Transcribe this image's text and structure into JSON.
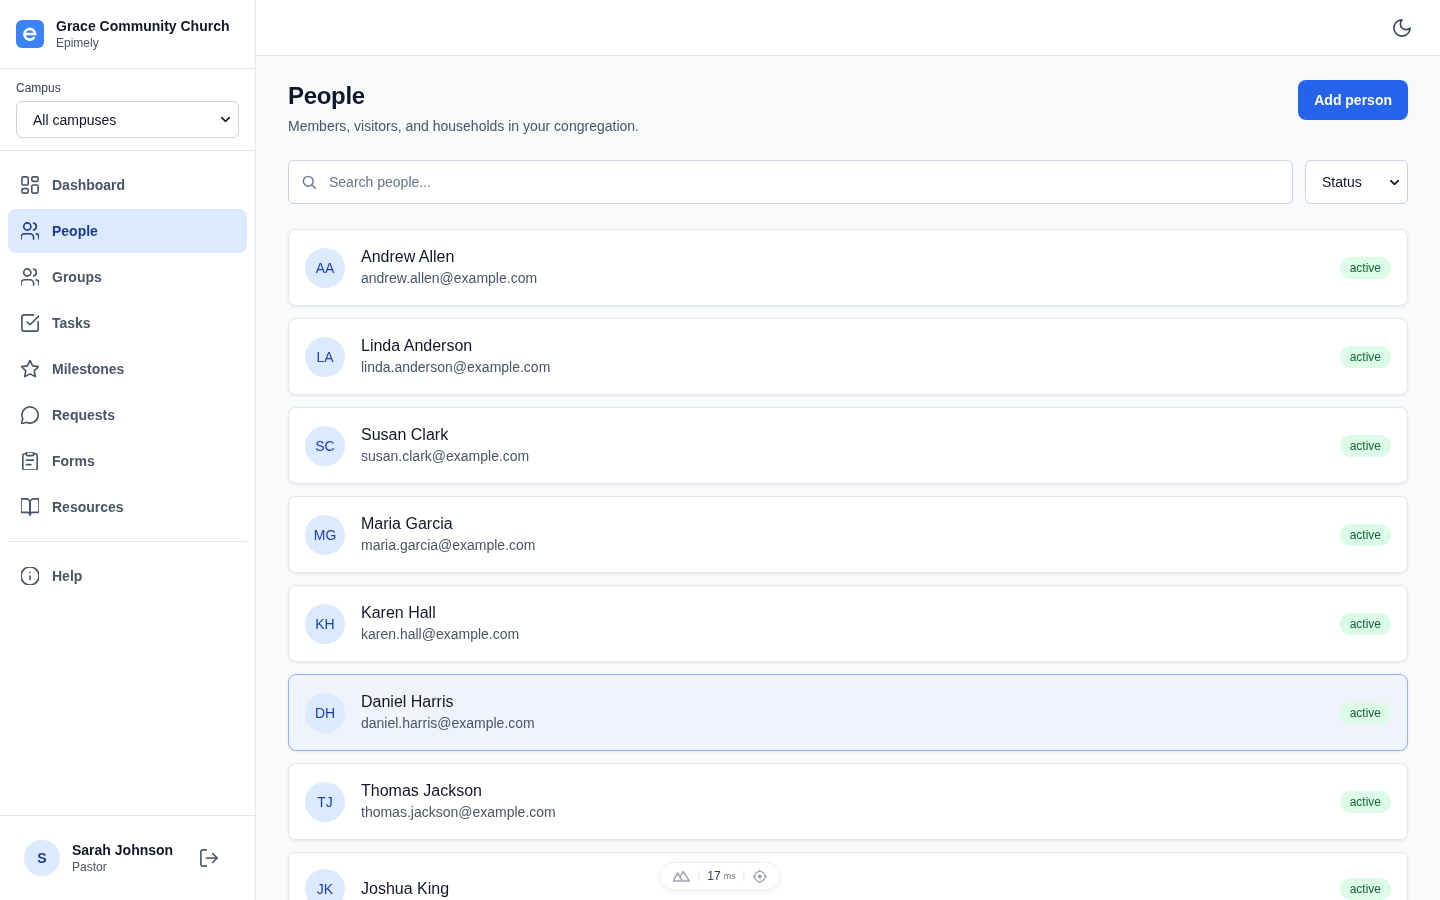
{
  "sidebar": {
    "org": {
      "name": "Grace Community Church",
      "subtitle": "Epimely"
    },
    "campus": {
      "label": "Campus",
      "value": "All campuses"
    },
    "nav": [
      {
        "label": "Dashboard",
        "selected": false
      },
      {
        "label": "People",
        "selected": true
      },
      {
        "label": "Groups",
        "selected": false
      },
      {
        "label": "Tasks",
        "selected": false
      },
      {
        "label": "Milestones",
        "selected": false
      },
      {
        "label": "Requests",
        "selected": false
      },
      {
        "label": "Forms",
        "selected": false
      },
      {
        "label": "Resources",
        "selected": false
      }
    ],
    "footer_nav": [
      {
        "label": "Help",
        "selected": false
      }
    ],
    "user": {
      "initials": "S",
      "name": "Sarah Johnson",
      "role": "Pastor"
    }
  },
  "page": {
    "title": "People",
    "subtitle": "Members, visitors, and households in your congregation.",
    "add_button": "Add person",
    "search": {
      "placeholder": "Search people..."
    },
    "status_filter": {
      "value": "Status"
    },
    "people": [
      {
        "initials": "AA",
        "name": "Andrew Allen",
        "email": "andrew.allen@example.com",
        "status": "active",
        "selected": false
      },
      {
        "initials": "LA",
        "name": "Linda Anderson",
        "email": "linda.anderson@example.com",
        "status": "active",
        "selected": false
      },
      {
        "initials": "SC",
        "name": "Susan Clark",
        "email": "susan.clark@example.com",
        "status": "active",
        "selected": false
      },
      {
        "initials": "MG",
        "name": "Maria Garcia",
        "email": "maria.garcia@example.com",
        "status": "active",
        "selected": false
      },
      {
        "initials": "KH",
        "name": "Karen Hall",
        "email": "karen.hall@example.com",
        "status": "active",
        "selected": false
      },
      {
        "initials": "DH",
        "name": "Daniel Harris",
        "email": "daniel.harris@example.com",
        "status": "active",
        "selected": true
      },
      {
        "initials": "TJ",
        "name": "Thomas Jackson",
        "email": "thomas.jackson@example.com",
        "status": "active",
        "selected": false
      },
      {
        "initials": "JK",
        "name": "Joshua King",
        "status": "active",
        "selected": false
      }
    ]
  },
  "dev_toolbar": {
    "value": "17",
    "unit": "ms"
  }
}
